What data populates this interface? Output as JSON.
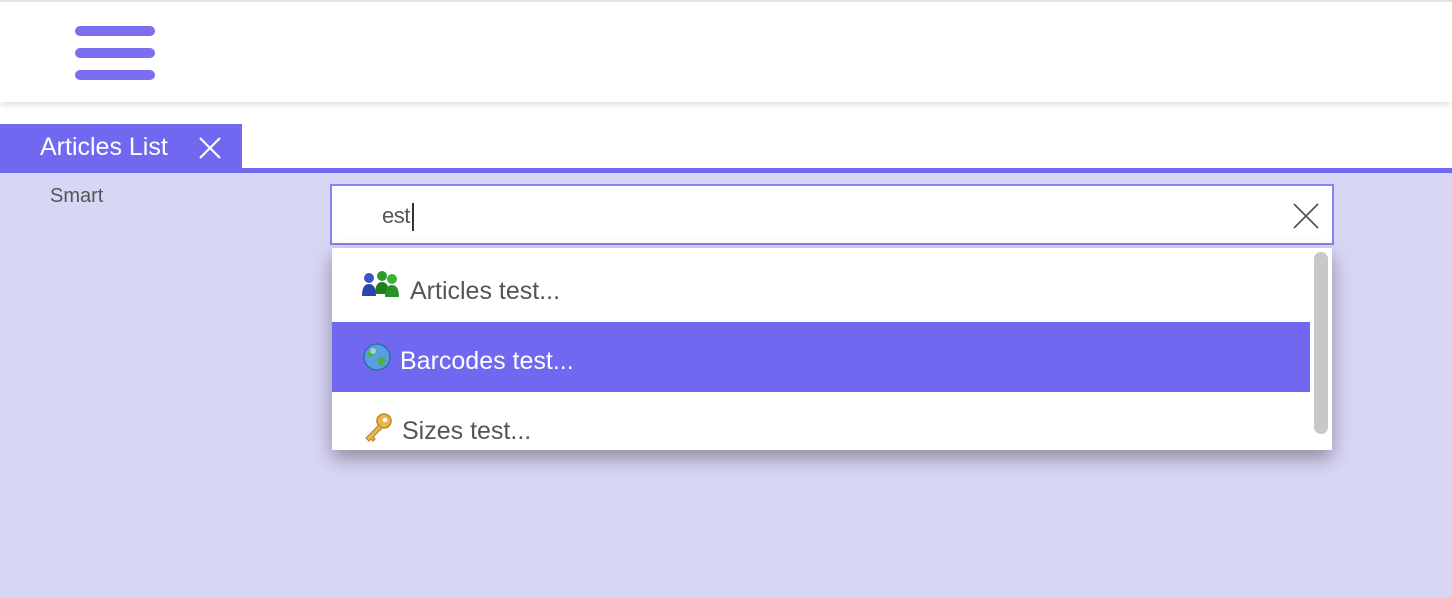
{
  "header": {
    "menu_icon": "hamburger-menu-icon"
  },
  "tabs": [
    {
      "label": "Articles List",
      "close_icon": "close-icon",
      "active": true
    }
  ],
  "form": {
    "field_label": "Smart",
    "search": {
      "value": "est",
      "clear_icon": "close-icon"
    }
  },
  "autocomplete": {
    "options": [
      {
        "label": "Articles test...",
        "icon": "users-group-icon",
        "selected": false
      },
      {
        "label": "Barcodes test...",
        "icon": "globe-icon",
        "selected": true
      },
      {
        "label": "Sizes test...",
        "icon": "key-icon",
        "selected": false
      }
    ]
  },
  "colors": {
    "accent": "#7068f0",
    "accent_light": "#7b6ff0",
    "background": "#d8d6f5",
    "text": "#555555"
  }
}
